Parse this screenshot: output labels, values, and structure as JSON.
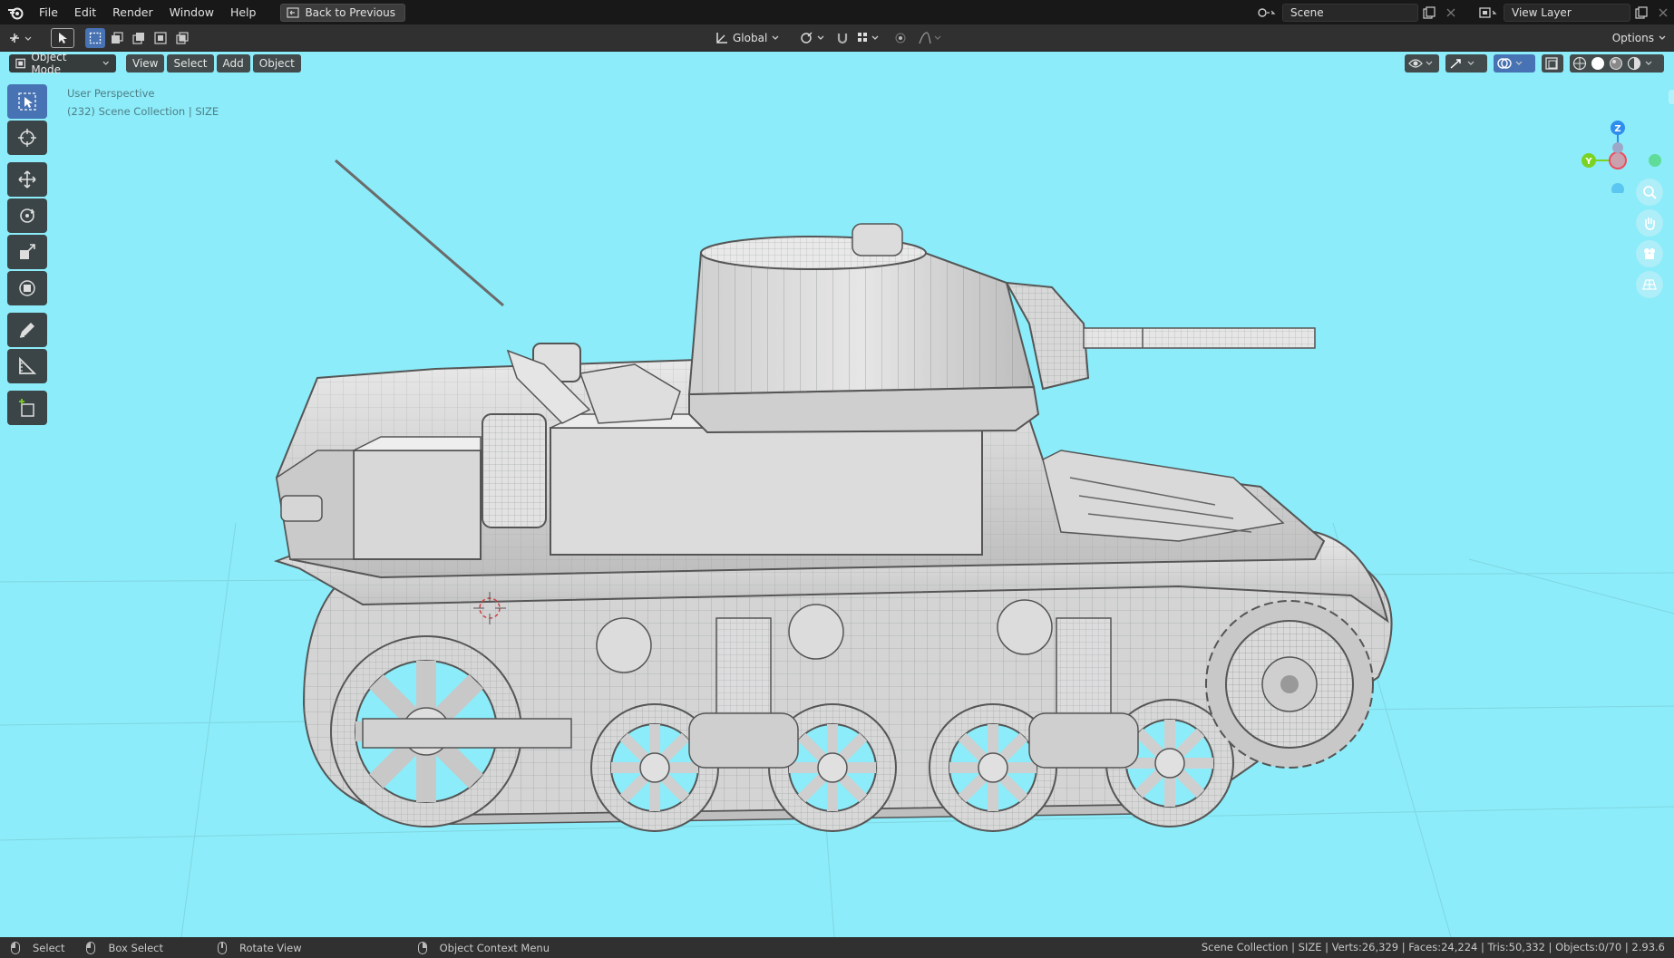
{
  "topbar": {
    "menus": [
      "File",
      "Edit",
      "Render",
      "Window",
      "Help"
    ],
    "back_button": "Back to Previous",
    "scene": "Scene",
    "view_layer": "View Layer"
  },
  "tool_header": {
    "transform_orientation": "Global",
    "options_label": "Options"
  },
  "viewport_header": {
    "mode": "Object Mode",
    "menus": [
      "View",
      "Select",
      "Add",
      "Object"
    ]
  },
  "viewport_overlay": {
    "perspective": "User Perspective",
    "collection": "(232) Scene Collection | SIZE"
  },
  "gizmo": {
    "axis_z": "Z",
    "axis_y": "Y"
  },
  "statusbar": {
    "select": "Select",
    "box_select": "Box Select",
    "rotate_view": "Rotate View",
    "context_menu": "Object Context Menu",
    "stats": "Scene Collection | SIZE | Verts:26,329 | Faces:24,224 | Tris:50,332 | Objects:0/70 | 2.93.6"
  },
  "colors": {
    "viewport_bg": "#8cecf9",
    "accent": "#4772b3",
    "axis_x": "#ee4d5e",
    "axis_y": "#7bd321",
    "axis_z": "#2f8ded"
  }
}
